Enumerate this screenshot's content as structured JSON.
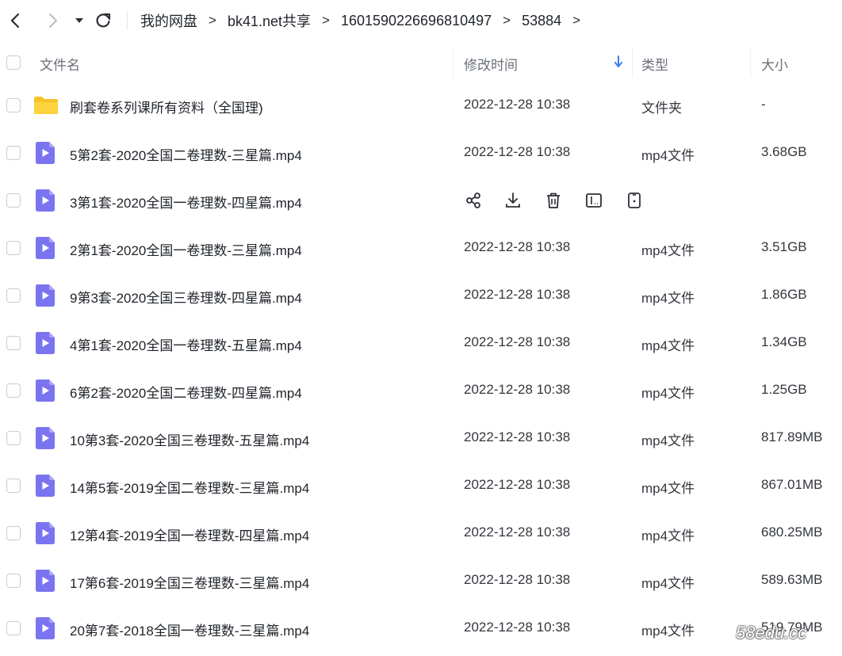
{
  "breadcrumb": [
    "我的网盘",
    "bk41.net共享",
    "1601590226696810497",
    "53884"
  ],
  "breadcrumb_sep": ">",
  "columns": {
    "name": "文件名",
    "modified": "修改时间",
    "type": "类型",
    "size": "大小"
  },
  "rows": [
    {
      "icon": "folder-icon",
      "name": "刷套卷系列课所有资料（全国理)",
      "time": "2022-12-28 10:38",
      "type": "文件夹",
      "size": "-"
    },
    {
      "icon": "video-file-icon",
      "name": "5第2套-2020全国二卷理数-三星篇.mp4",
      "time": "2022-12-28 10:38",
      "type": "mp4文件",
      "size": "3.68GB"
    },
    {
      "icon": "video-file-icon",
      "name": "3第1套-2020全国一卷理数-四星篇.mp4",
      "time": "",
      "type": "",
      "size": "",
      "hover_actions": [
        "share-icon",
        "download-icon",
        "delete-icon",
        "rename-icon",
        "more-icon"
      ]
    },
    {
      "icon": "video-file-icon",
      "name": "2第1套-2020全国一卷理数-三星篇.mp4",
      "time": "2022-12-28 10:38",
      "type": "mp4文件",
      "size": "3.51GB"
    },
    {
      "icon": "video-file-icon",
      "name": "9第3套-2020全国三卷理数-四星篇.mp4",
      "time": "2022-12-28 10:38",
      "type": "mp4文件",
      "size": "1.86GB"
    },
    {
      "icon": "video-file-icon",
      "name": "4第1套-2020全国一卷理数-五星篇.mp4",
      "time": "2022-12-28 10:38",
      "type": "mp4文件",
      "size": "1.34GB"
    },
    {
      "icon": "video-file-icon",
      "name": "6第2套-2020全国二卷理数-四星篇.mp4",
      "time": "2022-12-28 10:38",
      "type": "mp4文件",
      "size": "1.25GB"
    },
    {
      "icon": "video-file-icon",
      "name": "10第3套-2020全国三卷理数-五星篇.mp4",
      "time": "2022-12-28 10:38",
      "type": "mp4文件",
      "size": "817.89MB"
    },
    {
      "icon": "video-file-icon",
      "name": "14第5套-2019全国二卷理数-三星篇.mp4",
      "time": "2022-12-28 10:38",
      "type": "mp4文件",
      "size": "867.01MB"
    },
    {
      "icon": "video-file-icon",
      "name": "12第4套-2019全国一卷理数-四星篇.mp4",
      "time": "2022-12-28 10:38",
      "type": "mp4文件",
      "size": "680.25MB"
    },
    {
      "icon": "video-file-icon",
      "name": "17第6套-2019全国三卷理数-三星篇.mp4",
      "time": "2022-12-28 10:38",
      "type": "mp4文件",
      "size": "589.63MB"
    },
    {
      "icon": "video-file-icon",
      "name": "20第7套-2018全国一卷理数-三星篇.mp4",
      "time": "2022-12-28 10:38",
      "type": "mp4文件",
      "size": "519.79MB"
    }
  ],
  "watermark": "58edu.cc",
  "colors": {
    "folder": "#f7c325",
    "video_file": "#7a74f0",
    "sort_arrow": "#3d7bf5"
  }
}
